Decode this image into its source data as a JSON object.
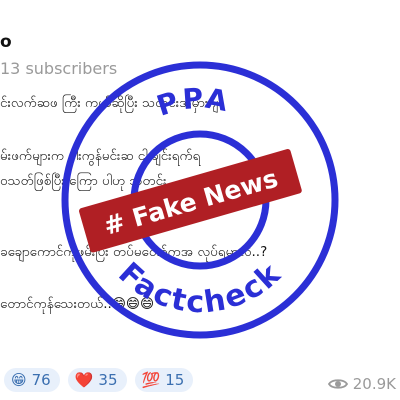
{
  "channel": {
    "name": "o",
    "subscribers": "13 subscribers"
  },
  "post": {
    "lines": [
      "င်းလက်ဆဖ ကြီး ကယ်ဆိုပြီး သတင်းအမှားဂျ",
      "မ်းဖက်များက ငါးကွန်မင်းဆ ငါးချင်းရက်ရ",
      "ဝသတ်ဖြစ်ပြီး ကြော ပါဟု သတင်း",
      "ခချောကောင်ကိုဖမ်းပြီး တပ်မတော်ကအ လုပ်ရမှာလဲ..?",
      "တောင်ကုန်သေးတယ်..😄😄😄"
    ]
  },
  "stamp": {
    "top_text": "PPA",
    "bottom_text": "Factcheck",
    "banner_text": "# Fake News",
    "ring_color": "#2b2fd6",
    "banner_color": "#b01f24",
    "banner_text_color": "#ffffff"
  },
  "reactions": [
    {
      "emoji": "😁",
      "count": "76"
    },
    {
      "emoji": "❤️",
      "count": "35"
    },
    {
      "emoji": "💯",
      "count": "15"
    }
  ],
  "views": {
    "icon": "eye-icon",
    "count": "20.9K"
  }
}
